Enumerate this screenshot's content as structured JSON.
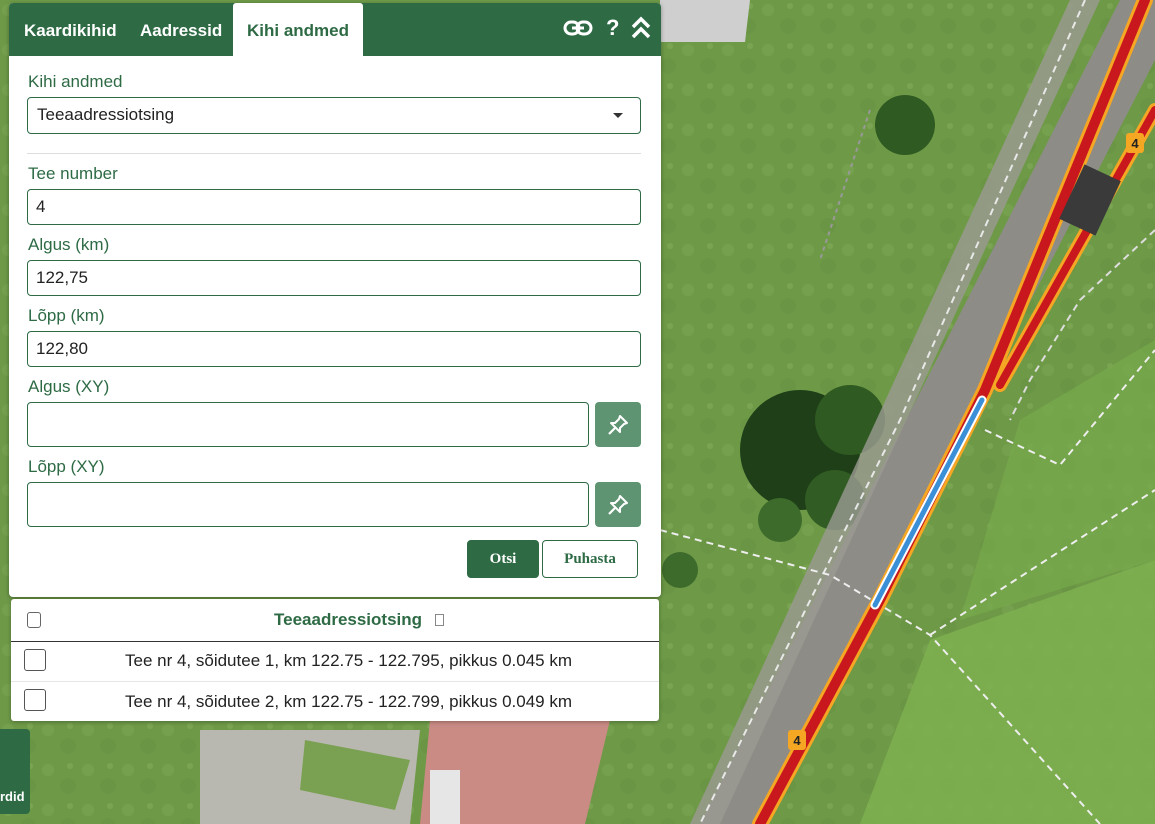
{
  "tabs": [
    {
      "label": "Kaardikihid",
      "active": false
    },
    {
      "label": "Aadressid",
      "active": false
    },
    {
      "label": "Kihi andmed",
      "active": true
    }
  ],
  "toolbar": {
    "link_icon": "link-icon",
    "help_label": "?",
    "collapse_icon": "double-chevron-up-icon"
  },
  "form": {
    "layer_label": "Kihi andmed",
    "layer_value": "Teeaadressiotsing",
    "road_number_label": "Tee number",
    "road_number_value": "4",
    "start_km_label": "Algus (km)",
    "start_km_value": "122,75",
    "end_km_label": "Lõpp (km)",
    "end_km_value": "122,80",
    "start_xy_label": "Algus (XY)",
    "start_xy_value": "",
    "end_xy_label": "Lõpp (XY)",
    "end_xy_value": "",
    "search_label": "Otsi",
    "clear_label": "Puhasta"
  },
  "results": {
    "title": "Teeaadressiotsing",
    "rows": [
      {
        "text": "Tee nr 4, sõidutee 1, km 122.75 - 122.795, pikkus 0.045 km",
        "checked": false
      },
      {
        "text": "Tee nr 4, sõidutee 2, km 122.75 - 122.799, pikkus 0.049 km",
        "checked": false
      }
    ]
  },
  "map": {
    "road_shield_label": "4",
    "corner_button_label": "rdid"
  },
  "colors": {
    "primary": "#2e6b45",
    "pick_button": "#5f9472",
    "road_highlight": "#c8171d",
    "road_edge": "#f5a623",
    "selection": "#3a8fd6",
    "grass": "#6f9a4a"
  }
}
